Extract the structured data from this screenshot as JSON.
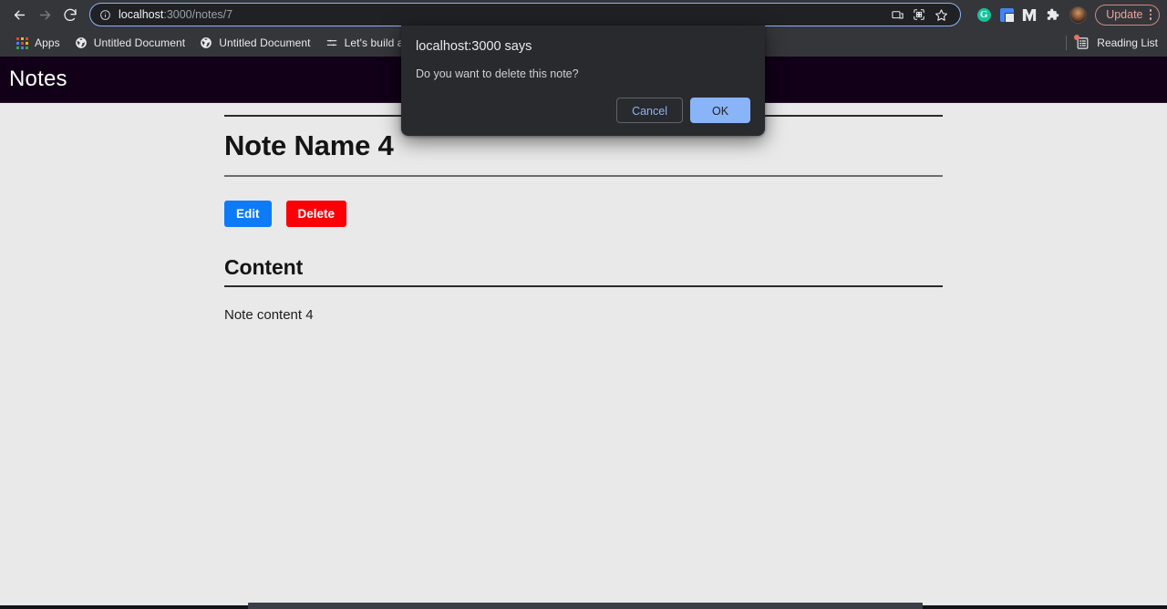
{
  "browser": {
    "nav": {
      "back_icon": "back-arrow-icon",
      "forward_icon": "forward-arrow-icon",
      "reload_icon": "reload-icon"
    },
    "omnibox": {
      "security_icon": "info-circle-icon",
      "url_host": "localhost",
      "url_path": ":3000/notes/7",
      "full_url": "localhost:3000/notes/7",
      "cast_icon": "cast-icon",
      "qr_icon": "qr-code-icon",
      "bookmark_icon": "star-icon"
    },
    "extensions": [
      {
        "name": "grammarly-extension-icon",
        "glyph": "G"
      },
      {
        "name": "google-translate-extension-icon",
        "glyph": ""
      },
      {
        "name": "medium-extension-icon",
        "glyph": ""
      },
      {
        "name": "extensions-puzzle-icon",
        "glyph": ""
      }
    ],
    "profile": {
      "name": "profile-avatar"
    },
    "update": {
      "label": "Update",
      "menu_icon": "kebab-menu-icon",
      "accent_color": "#e9a39b"
    },
    "bookmarks": [
      {
        "label": "Apps",
        "icon": "apps-grid-icon"
      },
      {
        "label": "Untitled Document",
        "icon": "globe-icon"
      },
      {
        "label": "Untitled Document",
        "icon": "globe-icon"
      },
      {
        "label": "Let's build a Rea",
        "icon": "reading-list-icon"
      }
    ],
    "reading_list": {
      "label": "Reading List",
      "icon": "reading-list-icon",
      "has_notification": true,
      "dot_color": "#e8715f"
    },
    "chrome_bg": "#35363a",
    "omnibox_bg": "#202124",
    "omnibox_focus_color": "#8ab4f8"
  },
  "page": {
    "navbar": {
      "brand": "Notes",
      "bg_color": "#110018",
      "text_color": "#ffffff"
    },
    "note": {
      "title": "Note Name 4",
      "buttons": {
        "edit": {
          "label": "Edit",
          "color": "#0d7bf7"
        },
        "delete": {
          "label": "Delete",
          "color": "#fb0007"
        }
      },
      "content_heading": "Content",
      "content_body": "Note content 4"
    },
    "body_bg": "#e9e9e9"
  },
  "dialog": {
    "origin": "localhost:3000 says",
    "message": "Do you want to delete this note?",
    "cancel_label": "Cancel",
    "ok_label": "OK",
    "bg_color": "#292a2d",
    "ok_bg": "#8ab4f8",
    "link_color": "#8ab4f8"
  }
}
